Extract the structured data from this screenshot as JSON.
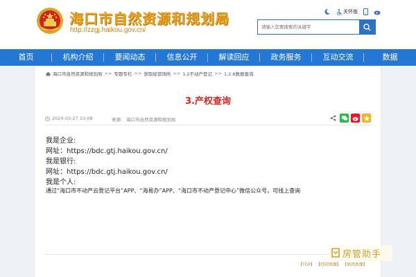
{
  "header": {
    "site_title": "海口市自然资源和规划局",
    "site_url": "http://zzgj.haikou.gov.cn/",
    "tools": {
      "accessibility_label": "关怀版"
    },
    "search": {
      "placeholder": "请输入您要搜索的关键字"
    }
  },
  "nav": {
    "items": [
      "首页",
      "机构介绍",
      "要闻动态",
      "信息公开",
      "解读回应",
      "政务服务",
      "互动交流",
      "数据"
    ]
  },
  "breadcrumb": {
    "items": [
      "海口市自然资源和规划局",
      "专题专栏",
      "获取经营场所",
      "1.2不动产登记",
      "1.2.6数据查询"
    ],
    "separator": ">>"
  },
  "article": {
    "title": "3.产权查询",
    "date": "2024-03-27 10:08",
    "source_label": "来源:",
    "source": "海口市自然资源和规划局",
    "lines": [
      "我是企业:",
      "网址：https://bdc.gtj.haikou.gov.cn/",
      "我是银行:",
      "网址：https://bdc.gtj.haikou.gov.cn/",
      "我是个人:",
      "通过“海口市不动产云登记平台”APP、“海易办”APP、“海口市不动产登记中心”微信公众号，可线上查询"
    ]
  },
  "footer": {
    "links": [
      "【TOP】",
      "【打印页面】",
      "【关闭页面】"
    ]
  },
  "watermark": {
    "text": "房管助手"
  },
  "colors": {
    "nav_blue": "#2478d4",
    "title_red": "#e02020",
    "brand_gold": "#e8a321"
  }
}
